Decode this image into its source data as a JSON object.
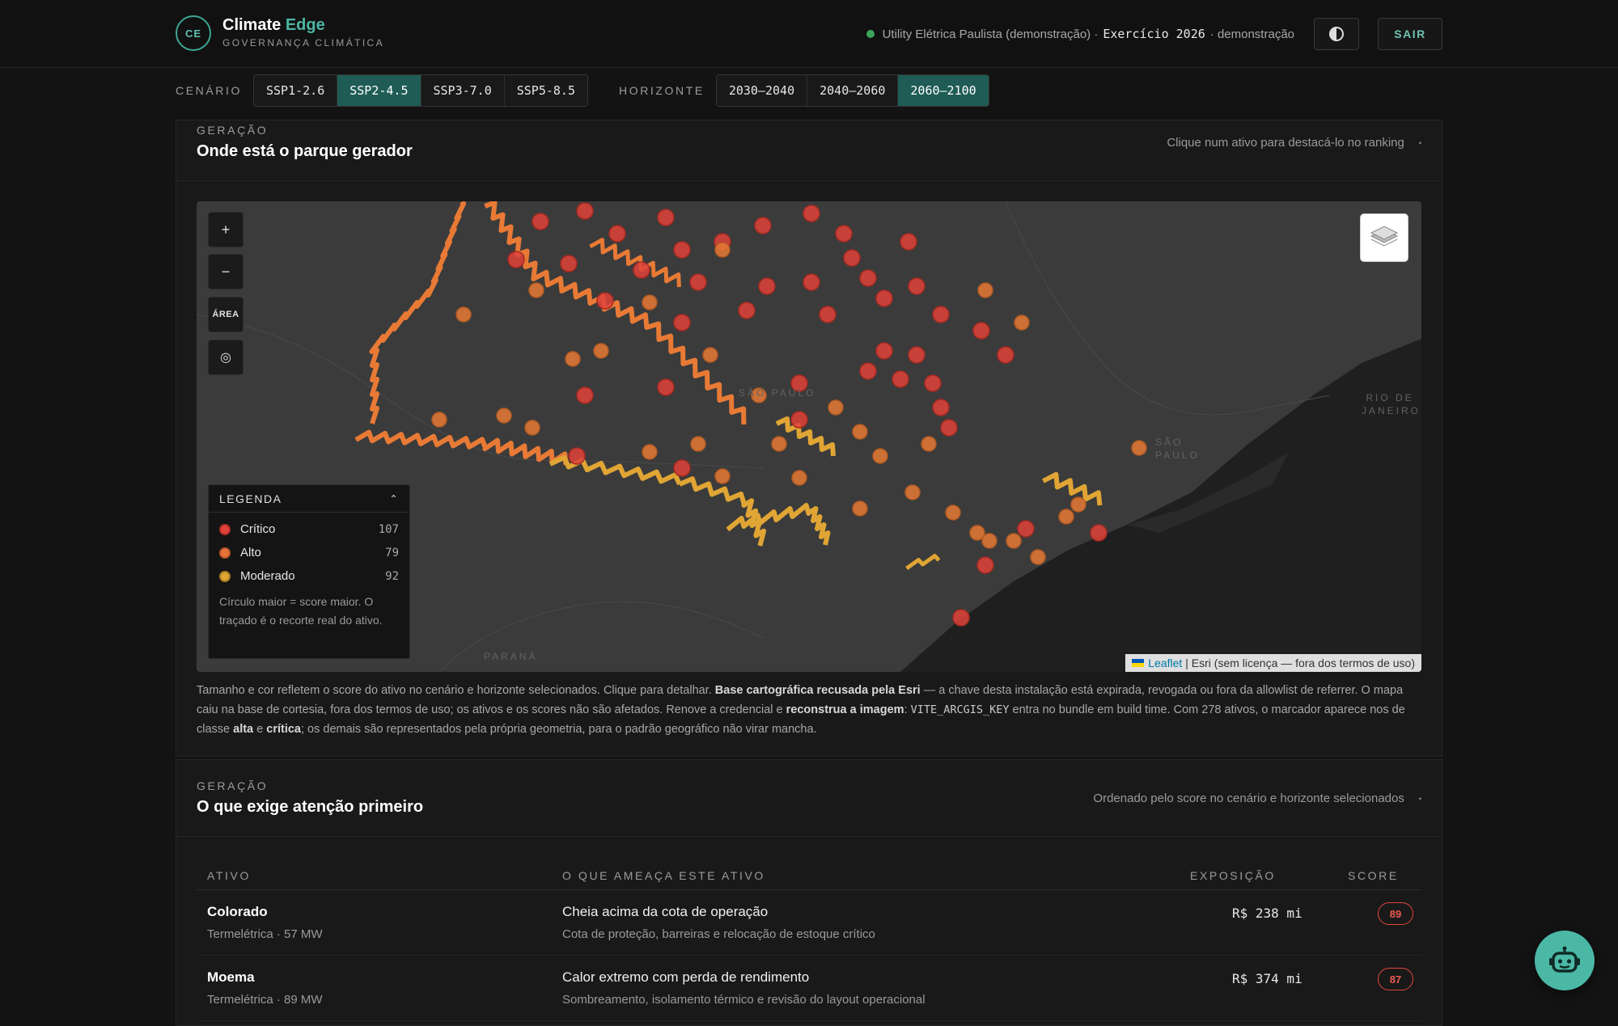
{
  "header": {
    "logo": "CE",
    "brand_a": "Climate",
    "brand_b": "Edge",
    "brand_sub": "GOVERNANÇA CLIMÁTICA",
    "company": "Utility Elétrica Paulista (demonstração) ·",
    "exercise": "Exercício 2026",
    "mode": "· demonstração",
    "logout": "SAIR",
    "status_color": "#3aa55a"
  },
  "filters": {
    "scenario_label": "CENÁRIO",
    "scenarios": [
      "SSP1-2.6",
      "SSP2-4.5",
      "SSP3-7.0",
      "SSP5-8.5"
    ],
    "scenario_active": "SSP2-4.5",
    "horizon_label": "HORIZONTE",
    "horizons": [
      "2030–2040",
      "2040–2060",
      "2060–2100"
    ],
    "horizon_active": "2060–2100"
  },
  "map_section": {
    "kicker": "GERAÇÃO",
    "title": "Onde está o parque gerador",
    "hint": "Clique num ativo para destacá-lo no ranking",
    "controls": {
      "zoom_in": "+",
      "zoom_out": "−",
      "area": "ÁREA",
      "locate": "◎"
    },
    "legend": {
      "title": "LEGENDA",
      "items": [
        {
          "label": "Crítico",
          "count": "107",
          "color": "#e0433a"
        },
        {
          "label": "Alto",
          "count": "79",
          "color": "#e8743a"
        },
        {
          "label": "Moderado",
          "count": "92",
          "color": "#e0a534"
        }
      ],
      "note": "Círculo maior = score maior. O traçado é o recorte real do ativo."
    },
    "labels": {
      "sp_state": "SÃO PAULO",
      "rj": "RIO DE JANEIRO",
      "sp_city": "SÃO PAULO",
      "parana": "PARANÁ"
    },
    "attribution_leaflet": "Leaflet",
    "attribution_rest": "| Esri (sem licença — fora dos termos de uso)",
    "caption": {
      "p1": "Tamanho e cor refletem o score do ativo no cenário e horizonte selecionados. Clique para detalhar. ",
      "b1": "Base cartográfica recusada pela Esri",
      "p2": " — a chave desta instalação está expirada, revogada ou fora da allowlist de referrer. O mapa caiu na base de cortesia, fora dos termos de uso; os ativos e os scores não são afetados. Renove a credencial e ",
      "b2": "reconstrua a imagem",
      "p3": ": ",
      "code": "VITE_ARCGIS_KEY",
      "p4": " entra no bundle em build time. Com 278 ativos, o marcador aparece nos de classe ",
      "b3": "alta",
      "p5": " e ",
      "b4": "crítica",
      "p6": "; os demais são representados pela própria geometria, para o padrão geográfico não virar mancha."
    }
  },
  "ranking": {
    "kicker": "GERAÇÃO",
    "title": "O que exige atenção primeiro",
    "hint": "Ordenado pelo score no cenário e horizonte selecionados",
    "columns": [
      "ATIVO",
      "O QUE AMEAÇA ESTE ATIVO",
      "EXPOSIÇÃO",
      "SCORE"
    ],
    "rows": [
      {
        "name": "Colorado",
        "meta": "Termelétrica · 57 MW",
        "threat": "Cheia acima da cota de operação",
        "mitigation": "Cota de proteção, barreiras e relocação de estoque crítico",
        "exposure": "R$ 238 mi",
        "score": "89"
      },
      {
        "name": "Moema",
        "meta": "Termelétrica · 89 MW",
        "threat": "Calor extremo com perda de rendimento",
        "mitigation": "Sombreamento, isolamento térmico e revisão do layout operacional",
        "exposure": "R$ 374 mi",
        "score": "87"
      }
    ]
  },
  "icons": {
    "theme": "contrast-icon",
    "layers": "layers-icon",
    "assistant": "robot-icon",
    "legend_toggle": "chevron-up-icon"
  }
}
